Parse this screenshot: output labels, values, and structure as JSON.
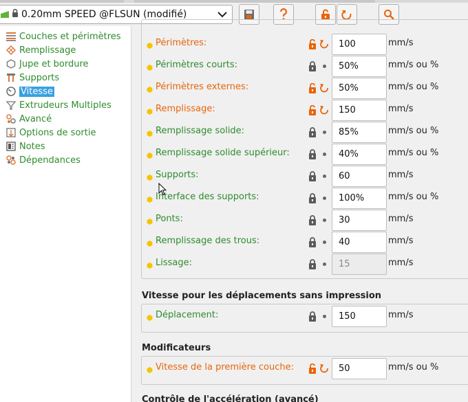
{
  "preset": {
    "label": "0.20mm SPEED @FLSUN (modifié)"
  },
  "toolbar": {
    "buttons": [
      {
        "icon": "save-icon"
      },
      {
        "icon": "question-icon"
      },
      {
        "icon": "lock-open-icon"
      },
      {
        "icon": "undo-icon"
      },
      {
        "icon": "search-icon"
      }
    ]
  },
  "sidebar": {
    "items": [
      {
        "label": "Couches et périmètres",
        "icon": "layers-icon"
      },
      {
        "label": "Remplissage",
        "icon": "infill-icon"
      },
      {
        "label": "Jupe et bordure",
        "icon": "skirt-icon"
      },
      {
        "label": "Supports",
        "icon": "supports-icon"
      },
      {
        "label": "Vitesse",
        "icon": "speed-icon",
        "active": true
      },
      {
        "label": "Extrudeurs Multiples",
        "icon": "funnel-icon"
      },
      {
        "label": "Avancé",
        "icon": "advanced-icon"
      },
      {
        "label": "Options de sortie",
        "icon": "output-icon"
      },
      {
        "label": "Notes",
        "icon": "notes-icon"
      },
      {
        "label": "Dépendances",
        "icon": "dependencies-icon"
      }
    ]
  },
  "sections": {
    "print_moves": {
      "rows": [
        {
          "label": "Périmètres:",
          "value": "100",
          "unit": "mm/s",
          "modified": true
        },
        {
          "label": "Périmètres courts:",
          "value": "50%",
          "unit": "mm/s ou %",
          "modified": false
        },
        {
          "label": "Périmètres externes:",
          "value": "50%",
          "unit": "mm/s ou %",
          "modified": true
        },
        {
          "label": "Remplissage:",
          "value": "150",
          "unit": "mm/s",
          "modified": true
        },
        {
          "label": "Remplissage solide:",
          "value": "85%",
          "unit": "mm/s ou %",
          "modified": false
        },
        {
          "label": "Remplissage solide supérieur:",
          "value": "40%",
          "unit": "mm/s ou %",
          "modified": false
        },
        {
          "label": "Supports:",
          "value": "60",
          "unit": "mm/s",
          "modified": false
        },
        {
          "label": "Interface des supports:",
          "value": "100%",
          "unit": "mm/s ou %",
          "modified": false
        },
        {
          "label": "Ponts:",
          "value": "30",
          "unit": "mm/s",
          "modified": false
        },
        {
          "label": "Remplissage des trous:",
          "value": "40",
          "unit": "mm/s",
          "modified": false
        },
        {
          "label": "Lissage:",
          "value": "15",
          "unit": "mm/s",
          "modified": false,
          "disabled": true
        }
      ]
    },
    "travel": {
      "title": "Vitesse pour les déplacements sans impression",
      "rows": [
        {
          "label": "Déplacement:",
          "value": "150",
          "unit": "mm/s",
          "modified": false
        }
      ]
    },
    "modifiers": {
      "title": "Modificateurs",
      "rows": [
        {
          "label": "Vitesse de la première couche:",
          "value": "50",
          "unit": "mm/s ou %",
          "modified": true
        }
      ]
    },
    "acceleration": {
      "title": "Contrôle de l'accélération (avancé)"
    }
  },
  "colors": {
    "system_value": "#2e8b2e",
    "modified_value": "#e8650a",
    "dot": "#f5c400",
    "active_item": "#3aa0e0"
  }
}
